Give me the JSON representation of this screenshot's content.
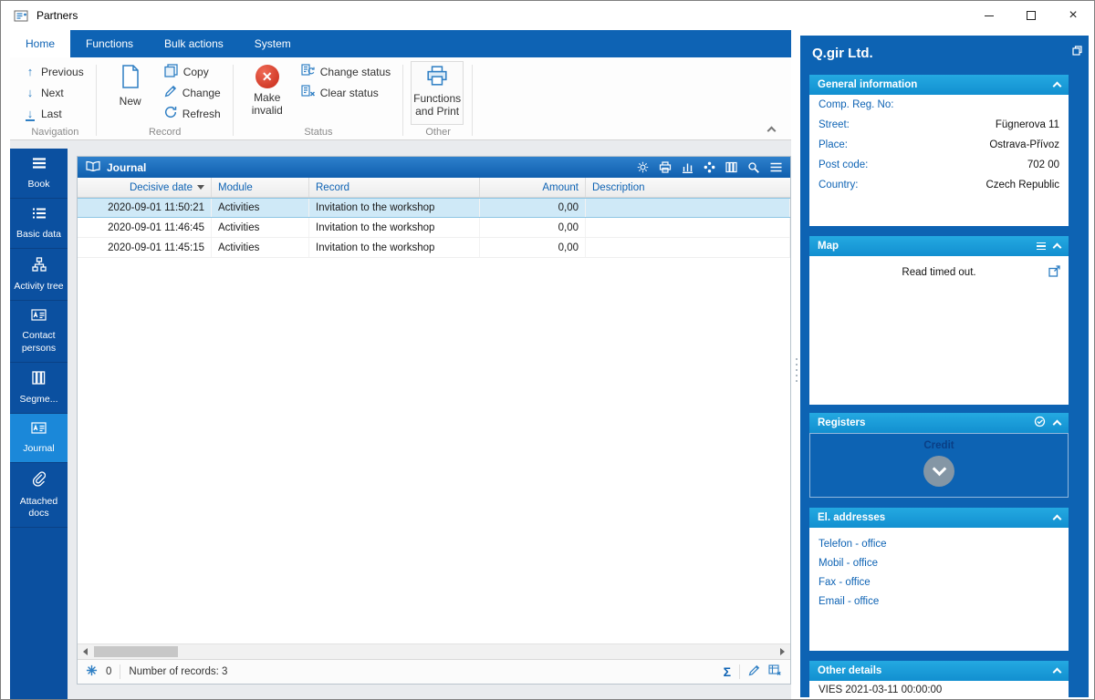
{
  "window": {
    "title": "Partners"
  },
  "tabs": [
    {
      "label": "Home"
    },
    {
      "label": "Functions"
    },
    {
      "label": "Bulk actions"
    },
    {
      "label": "System"
    }
  ],
  "ribbon": {
    "navigation": {
      "group_label": "Navigation",
      "previous": "Previous",
      "next": "Next",
      "last": "Last"
    },
    "record": {
      "group_label": "Record",
      "new": "New",
      "copy": "Copy",
      "change": "Change",
      "refresh": "Refresh"
    },
    "status": {
      "group_label": "Status",
      "make_invalid": "Make invalid",
      "change_status": "Change status",
      "clear_status": "Clear status"
    },
    "other": {
      "group_label": "Other",
      "functions_print": "Functions and Print"
    }
  },
  "sidebar": {
    "items": [
      {
        "label": "Book"
      },
      {
        "label": "Basic data"
      },
      {
        "label": "Activity tree"
      },
      {
        "label": "Contact persons"
      },
      {
        "label": "Segme..."
      },
      {
        "label": "Journal"
      },
      {
        "label": "Attached docs"
      }
    ]
  },
  "journal": {
    "title": "Journal",
    "columns": {
      "date": "Decisive date",
      "module": "Module",
      "record": "Record",
      "amount": "Amount",
      "description": "Description"
    },
    "rows": [
      {
        "date": "2020-09-01 11:50:21",
        "module": "Activities",
        "record": "Invitation to the workshop",
        "amount": "0,00",
        "description": ""
      },
      {
        "date": "2020-09-01 11:46:45",
        "module": "Activities",
        "record": "Invitation to the workshop",
        "amount": "0,00",
        "description": ""
      },
      {
        "date": "2020-09-01 11:45:15",
        "module": "Activities",
        "record": "Invitation to the workshop",
        "amount": "0,00",
        "description": ""
      }
    ],
    "statusbar": {
      "counter": "0",
      "records_label": "Number of records: 3",
      "sum_symbol": "Σ"
    }
  },
  "detail": {
    "company_name": "Q.gir Ltd.",
    "general_information": {
      "title": "General information",
      "rows": [
        {
          "label": "Comp. Reg. No:",
          "value": ""
        },
        {
          "label": "Street:",
          "value": "Fügnerova 11"
        },
        {
          "label": "Place:",
          "value": "Ostrava-Přívoz"
        },
        {
          "label": "Post code:",
          "value": "702 00"
        },
        {
          "label": "Country:",
          "value": "Czech Republic"
        }
      ]
    },
    "map": {
      "title": "Map",
      "message": "Read timed out."
    },
    "registers": {
      "title": "Registers",
      "item_label": "Credit"
    },
    "el_addresses": {
      "title": "El. addresses",
      "items": [
        {
          "label": "Telefon - office"
        },
        {
          "label": "Mobil - office"
        },
        {
          "label": "Fax - office"
        },
        {
          "label": "Email - office"
        }
      ]
    },
    "other_details": {
      "title": "Other details",
      "partial_text": "VIES 2021-03-11 00:00:00"
    }
  },
  "colors": {
    "accent_blue": "#0e63b4",
    "panel_blue": "#0d63b3",
    "sidebar_blue": "#0b50a0",
    "sidebar_active": "#1b88d9",
    "section_header_blue": "#18a0dc",
    "selected_row": "#cfe9f7",
    "invalid_red": "#d9362b",
    "icon_blue": "#2f7fc4"
  }
}
